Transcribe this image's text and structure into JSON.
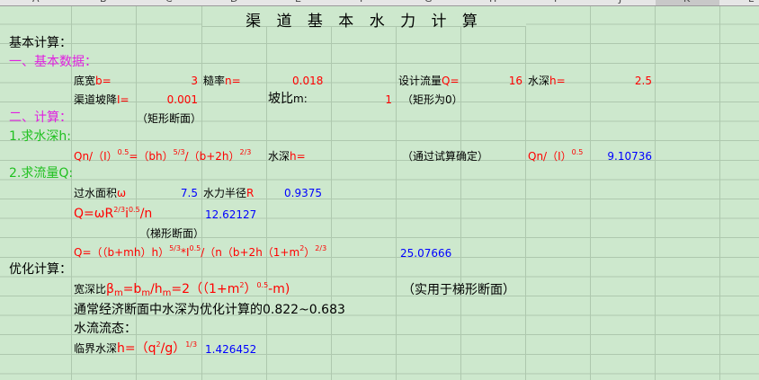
{
  "columns": [
    "A",
    "B",
    "C",
    "D",
    "E",
    "F",
    "G",
    "H",
    "I",
    "J",
    "K",
    "L"
  ],
  "title": "渠 道 基 本 水 力 计 算",
  "basic_calc": "基本计算：",
  "section1": "一、基本数据：",
  "row_width": {
    "label": "底宽",
    "var": "b=",
    "value": "3"
  },
  "row_rough": {
    "label": "糙率",
    "var": "n=",
    "value": "0.018"
  },
  "row_flow": {
    "label": "设计流量",
    "var": "Q=",
    "value": "16"
  },
  "row_depth": {
    "label": "水深",
    "var": "h=",
    "value": "2.5"
  },
  "row_slope": {
    "label": "渠道坡降",
    "var": "I=",
    "value": "0.001"
  },
  "row_side": {
    "label": "坡比",
    "var": "m",
    "colon": ":",
    "value": "1",
    "note": "（矩形为0）"
  },
  "section2": "二、计算：",
  "rect_note": "（矩形断面）",
  "step1": "1.求水深h:",
  "formula1_a": "Qn/（I）",
  "formula1_b": "=（bh）",
  "formula1_c": "/（b+2h）",
  "formula1_sup1": "0.5",
  "formula1_sup2": "5/3",
  "formula1_sup3": "2/3",
  "depth_label": "水深h=",
  "trial_note": "（通过试算确定）",
  "formula1_right_a": "Qn/（I）",
  "formula1_right_sup": "0.5",
  "formula1_value": "9.10736",
  "step2": "2.求流量Q:",
  "area_label": "过水面积",
  "area_sym": "ω",
  "area_value": "7.5",
  "radius_label": "水力半径",
  "radius_sym": "R",
  "radius_value": "0.9375",
  "q_formula_a": "Q=ωR",
  "q_formula_sup": "2/3",
  "q_formula_b": "i",
  "q_formula_sup2": "0.5",
  "q_formula_c": "/n",
  "q_value": "12.62127",
  "trap_note": "（梯形断面）",
  "q2_formula_a": "Q=（（b+mh）h）",
  "q2_formula_sup1": "5/3",
  "q2_formula_b": "*I",
  "q2_formula_sup2": "0.5",
  "q2_formula_c": "/（n（b+2h（1+m",
  "q2_formula_sup3": "2",
  "q2_formula_d": "）",
  "q2_formula_sup4": "2/3",
  "q2_formula_e": "）",
  "q2_value": "25.07666",
  "optimize": "优化计算：",
  "ratio_label": "宽深比",
  "ratio_formula_a": "β",
  "ratio_formula_b": "m=b",
  "ratio_formula_c": "m/h",
  "ratio_formula_d": "m=2（（1+m",
  "ratio_formula_sup1": "2",
  "ratio_formula_e": "）",
  "ratio_formula_sup2": "0.5",
  "ratio_formula_f": "-m)",
  "ratio_note": "（实用于梯形断面）",
  "econ_note": "通常经济断面中水深为优化计算的0.822~0.683",
  "flow_state": "水流流态：",
  "critical_label": "临界水深",
  "critical_formula_a": "h=（q",
  "critical_formula_sup1": "2",
  "critical_formula_b": "/g）",
  "critical_formula_sup2": "1/3",
  "critical_value": "1.426452"
}
